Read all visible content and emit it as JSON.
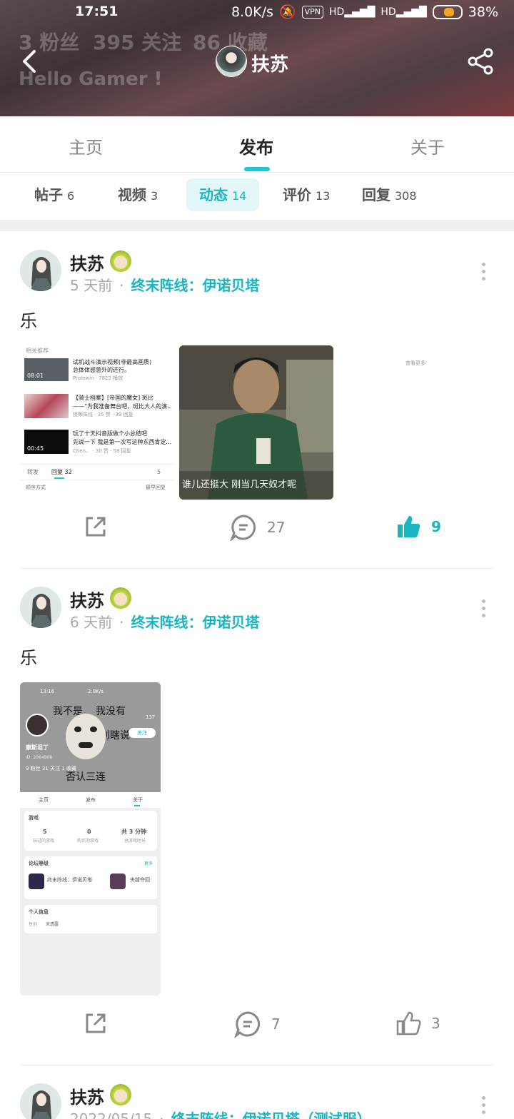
{
  "status_bar": {
    "time": "17:51",
    "speed": "8.0K/s",
    "vpn": "VPN",
    "battery": "38%"
  },
  "profile_bg": {
    "fans": "3 粉丝",
    "follows": "395 关注",
    "favs": "86 收藏",
    "greeting": "Hello Gamer !"
  },
  "header": {
    "name": "扶苏"
  },
  "main_tabs": [
    {
      "label": "主页"
    },
    {
      "label": "发布"
    },
    {
      "label": "关于"
    }
  ],
  "sub_tabs": [
    {
      "label": "帖子",
      "count": "6"
    },
    {
      "label": "视频",
      "count": "3"
    },
    {
      "label": "动态",
      "count": "14"
    },
    {
      "label": "评价",
      "count": "13"
    },
    {
      "label": "回复",
      "count": "308"
    }
  ],
  "posts": [
    {
      "author": "扶苏",
      "time": "5 天前",
      "dot": "·",
      "game": "终末阵线：伊诺贝塔",
      "text": "乐",
      "comments": "27",
      "likes": "9"
    },
    {
      "author": "扶苏",
      "time": "6 天前",
      "dot": "·",
      "game": "终末阵线：伊诺贝塔",
      "text": "乐",
      "comments": "7",
      "likes": "3"
    },
    {
      "author": "扶苏",
      "time": "2022/05/15",
      "dot": "·",
      "game": "终末阵线：伊诺贝塔（测试服）"
    }
  ],
  "shot1": {
    "related": "相关推荐",
    "rows": [
      {
        "title": "试机战斗演示视频(非最高画质)",
        "sub": "总体体感意外的还行。",
        "meta": "Prolewin · 7822 播放",
        "dur": "08:01"
      },
      {
        "title": "【骑士档案】[帝国的魔女] 斑比",
        "sub": "——“为我准备舞台吧，斑比大人的演...",
        "meta": "授荣阵线 · 35 赞 · 39 回复",
        "dur": ""
      },
      {
        "title": "玩了十天抖音版做个小总结吧",
        "sub": "先说一下 我是第一次写这种东西肯定...",
        "meta": "Chen、 · 30 赞 · 58 回复",
        "dur": "00:45"
      }
    ],
    "bar_forward": "转发",
    "bar_reply": "回复 32",
    "bar_like": "5",
    "sort": "顺序方式",
    "sort_r": "最早回复"
  },
  "shot2": {
    "caption": "谁儿还挺大 刚当几天奴才呢"
  },
  "shot3": {
    "more": "查看更多"
  },
  "shot4": {
    "time": "13:16",
    "speed": "2.9K/s",
    "meme1": "我不是",
    "meme2": "我没有",
    "meme3": "别瞎说",
    "meme4": "否认三连",
    "likes": "137",
    "follow": "关注",
    "name": "康斯坦丁",
    "uid": "ID: 2064908",
    "stats": "9 粉丝  31 关注  1 收藏",
    "tabs": [
      "主页",
      "发布",
      "关于"
    ],
    "games_title": "游戏",
    "games_stats": [
      {
        "v": "5",
        "l": "玩过的游戏"
      },
      {
        "v": "0",
        "l": "购买的游戏"
      },
      {
        "v": "共 3 分钟",
        "l": "总游戏时长"
      }
    ],
    "forum_title": "论坛等级",
    "forum_more": "更多",
    "forum_items": [
      "终末阵线：伊诺贝塔",
      "夹缝夺回"
    ],
    "info_title": "个人信息",
    "info_label": "性别",
    "info_value": "未透露"
  }
}
